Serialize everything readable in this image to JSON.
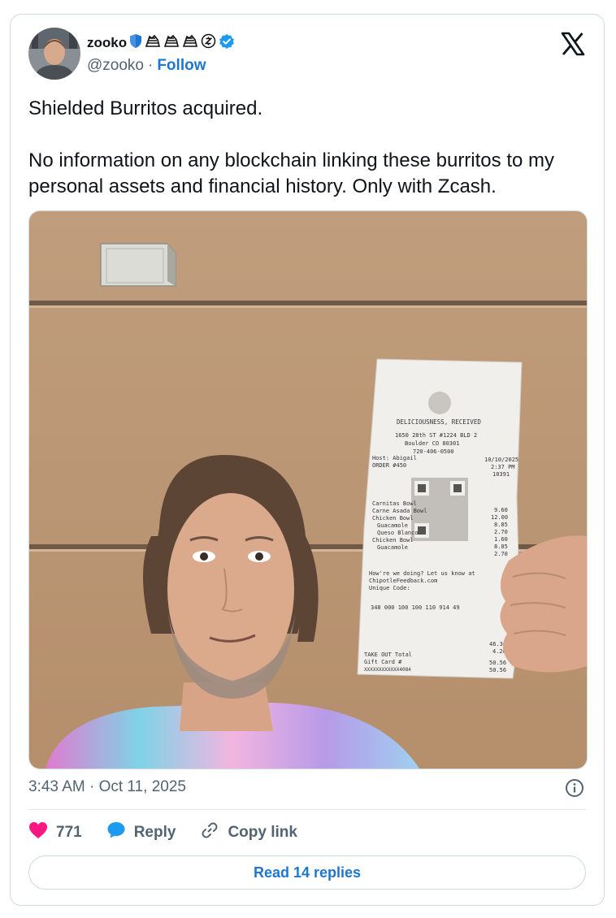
{
  "user": {
    "display_name": "zooko",
    "handle": "@zooko",
    "separator": "·",
    "follow_label": "Follow"
  },
  "tweet": {
    "lines": [
      "Shielded Burritos acquired.",
      "No information on any blockchain linking these burritos to my personal assets and financial history. Only with Zcash."
    ],
    "timestamp": "3:43 AM · Oct 11, 2025"
  },
  "receipt": {
    "header": "DELICIOUSNESS, RECEIVED",
    "address": "1650 28th ST #1224 BLD 2",
    "city": "Boulder CO 80301",
    "phone": "720-406-0500",
    "host": "Host: Abigail",
    "order": "ORDER #450",
    "date": "10/10/2025",
    "time": "2:37 PM",
    "ticket": "10391",
    "items": [
      {
        "name": "Carnitas Bowl",
        "price": "9.60"
      },
      {
        "name": "Carne Asada Bowl",
        "price": "12.00"
      },
      {
        "name": "Chicken Bowl",
        "price": "8.85"
      },
      {
        "name": "Guacamole",
        "price": "2.70"
      },
      {
        "name": "Queso Blanco",
        "price": "1.60"
      },
      {
        "name": "Chicken Bowl",
        "price": "8.85"
      },
      {
        "name": "Guacamole",
        "price": "2.70"
      }
    ],
    "feedback_1": "How're we doing? Let us know at",
    "feedback_2": "ChipotleFeedback.com",
    "feedback_3": "Unique Code:",
    "code": "348 000 100 100 110 914 49",
    "subtotal": "46.30",
    "tax": "4.26",
    "total_label": "TAKE OUT Total",
    "total": "50.56",
    "gift_label": "Gift Card #",
    "gift_number": "XXXXXXXXXXXX4084",
    "gift_amount": "50.56"
  },
  "engagement": {
    "likes": "771",
    "reply_label": "Reply",
    "copy_link_label": "Copy link",
    "read_replies_label": "Read 14 replies"
  },
  "colors": {
    "accent": "#1d77d1",
    "like": "#f91880",
    "verified": "#1d9bf0",
    "wall": "#b89573"
  },
  "icons": {
    "logo": "x-logo-icon",
    "verified": "verified-badge-icon",
    "like": "heart-icon",
    "reply": "speech-bubble-icon",
    "copy": "link-icon",
    "info": "info-icon"
  }
}
